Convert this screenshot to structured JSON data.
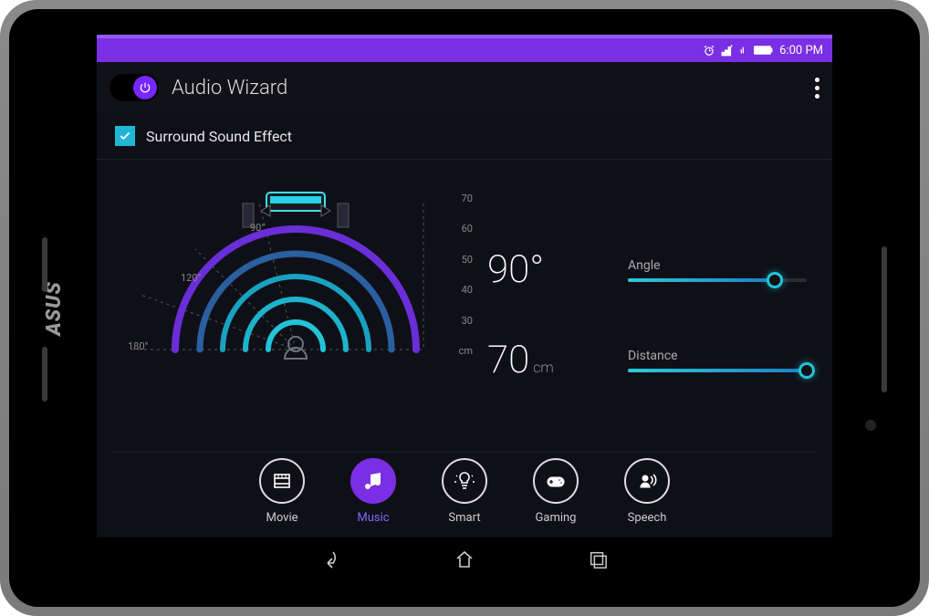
{
  "status": {
    "time": "6:00 PM"
  },
  "header": {
    "title": "Audio Wizard",
    "power_on": true
  },
  "surround": {
    "label": "Surround Sound Effect",
    "checked": true
  },
  "viz": {
    "angle_labels": [
      "90°",
      "120°",
      "180°"
    ],
    "distance_ticks": [
      "70",
      "60",
      "50",
      "40",
      "30",
      "cm"
    ]
  },
  "angle": {
    "value": "90°",
    "label": "Angle",
    "percent": 82
  },
  "distance": {
    "value": "70",
    "unit": "cm",
    "label": "Distance",
    "percent": 100
  },
  "modes": [
    {
      "key": "movie",
      "label": "Movie"
    },
    {
      "key": "music",
      "label": "Music",
      "active": true
    },
    {
      "key": "smart",
      "label": "Smart"
    },
    {
      "key": "gaming",
      "label": "Gaming"
    },
    {
      "key": "speech",
      "label": "Speech"
    }
  ]
}
